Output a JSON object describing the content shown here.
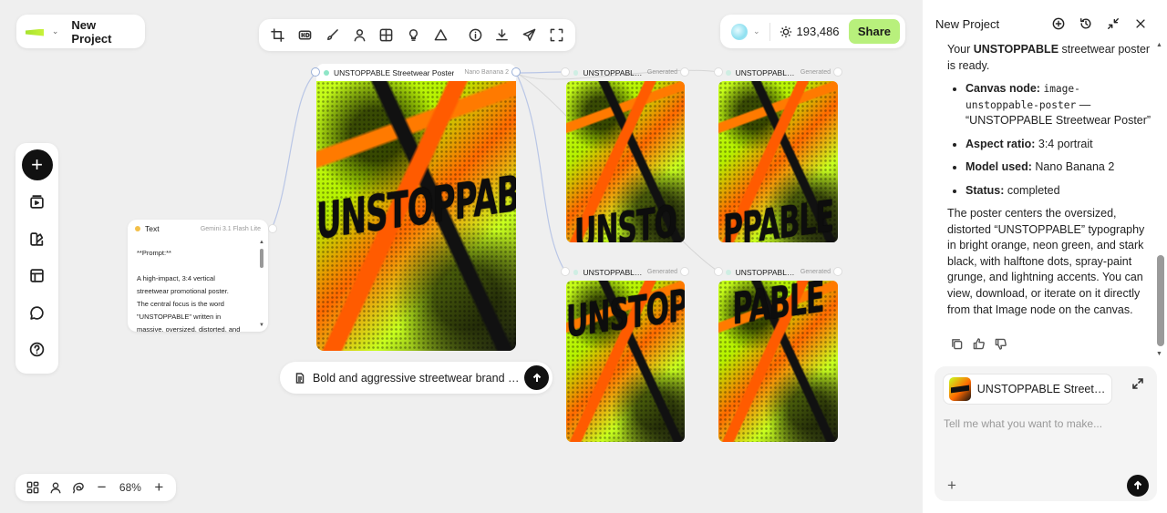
{
  "project": {
    "name": "New Project"
  },
  "header": {
    "credits": "193,486",
    "share_label": "Share"
  },
  "canvas": {
    "zoom": "68%",
    "text_node": {
      "title": "Text",
      "model": "Gemini 3.1 Flash Lite",
      "lines": [
        "**Prompt:**",
        "",
        "A high-impact, 3:4 vertical",
        "streetwear promotional poster.",
        "The central focus is the word",
        "\"UNSTOPPABLE\" written in",
        "massive, oversized, distorted, and"
      ]
    },
    "main_image": {
      "title": "UNSTOPPABLE Streetwear Poster",
      "model": "Nano Banana 2",
      "word": "UNSTOPPABLE"
    },
    "generated": [
      {
        "title": "UNSTOPPABLE ...",
        "status": "Generated",
        "word": "UNSTO"
      },
      {
        "title": "UNSTOPPABLE ...",
        "status": "Generated",
        "word": "PPABLE"
      },
      {
        "title": "UNSTOPPABLE ...",
        "status": "Generated",
        "word": "UNSTOP"
      },
      {
        "title": "UNSTOPPABLE ...",
        "status": "Generated",
        "word": "PABLE"
      }
    ],
    "prompt_pill": "Bold and aggressive streetwear brand pr..."
  },
  "panel": {
    "title": "New Project",
    "intro_pre": "Your ",
    "intro_bold": "UNSTOPPABLE",
    "intro_post": " streetwear poster is ready.",
    "items": [
      {
        "label": "Canvas node:",
        "code": "image-unstoppable-poster",
        "rest": " — “UNSTOPPABLE Streetwear Poster”"
      },
      {
        "label": "Aspect ratio:",
        "value": " 3:4 portrait"
      },
      {
        "label": "Model used:",
        "value": " Nano Banana 2"
      },
      {
        "label": "Status:",
        "value": " completed"
      }
    ],
    "description": "The poster centers the oversized, distorted “UNSTOPPABLE” typography in bright orange, neon green, and stark black, with halftone dots, spray-paint grunge, and lightning accents. You can view, download, or iterate on it directly from that Image node on the canvas.",
    "attachment": "UNSTOPPABLE Streetwe...",
    "input_placeholder": "Tell me what you want to make..."
  }
}
